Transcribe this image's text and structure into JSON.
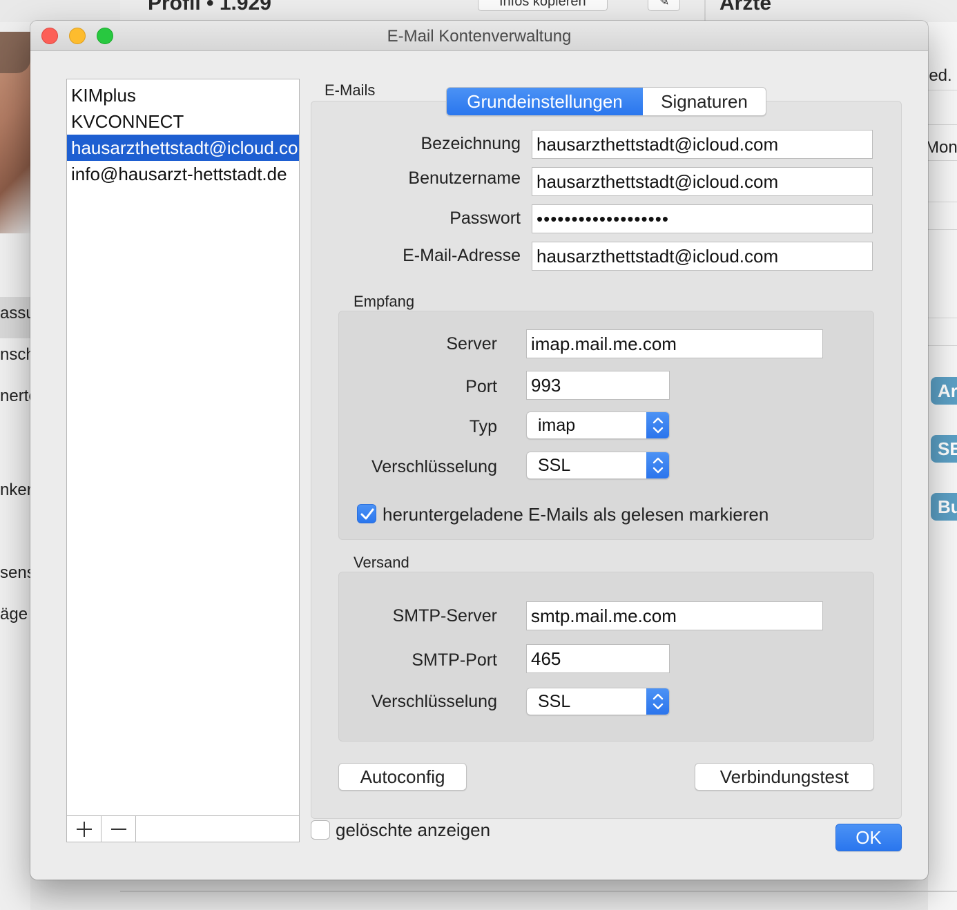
{
  "background": {
    "header_title": "Profil • 1.929",
    "header_button": "Infos kopieren",
    "header_right_title": "Ärzte",
    "left_sidebar_texts": [
      "assu",
      "nsch",
      "nerte",
      "nker",
      "sens",
      "äge"
    ],
    "right_texts": [
      "ied.",
      "Moni"
    ],
    "right_badges": [
      "Ar",
      "SE",
      "Bu"
    ]
  },
  "window": {
    "title": "E-Mail Kontenverwaltung"
  },
  "accounts": {
    "items": [
      "KIMplus",
      "KVCONNECT",
      "hausarzthettstadt@icloud.com",
      "info@hausarzt-hettstadt.de"
    ],
    "selected_index": 2,
    "add_label": "+",
    "remove_label": "—"
  },
  "emails": {
    "group_label": "E-Mails",
    "tabs": [
      {
        "label": "Grundeinstellungen",
        "active": true
      },
      {
        "label": "Signaturen",
        "active": false
      }
    ],
    "fields": {
      "bezeichnung": {
        "label": "Bezeichnung",
        "value": "hausarzthettstadt@icloud.com"
      },
      "benutzername": {
        "label": "Benutzername",
        "value": "hausarzthettstadt@icloud.com"
      },
      "passwort": {
        "label": "Passwort",
        "value": "•••••••••••••••••••"
      },
      "email_adresse": {
        "label": "E-Mail-Adresse",
        "value": "hausarzthettstadt@icloud.com"
      }
    },
    "empfang": {
      "group_label": "Empfang",
      "server": {
        "label": "Server",
        "value": "imap.mail.me.com"
      },
      "port": {
        "label": "Port",
        "value": "993"
      },
      "typ": {
        "label": "Typ",
        "value": "imap"
      },
      "verschluesselung": {
        "label": "Verschlüsselung",
        "value": "SSL"
      },
      "mark_read": {
        "label": "heruntergeladene E-Mails als gelesen markieren",
        "checked": true
      }
    },
    "versand": {
      "group_label": "Versand",
      "smtp_server": {
        "label": "SMTP-Server",
        "value": "smtp.mail.me.com"
      },
      "smtp_port": {
        "label": "SMTP-Port",
        "value": "465"
      },
      "verschluesselung": {
        "label": "Verschlüsselung",
        "value": "SSL"
      }
    },
    "autoconfig_label": "Autoconfig",
    "verbindungstest_label": "Verbindungstest"
  },
  "show_deleted": {
    "label": "gelöschte anzeigen",
    "checked": false
  },
  "ok_label": "OK",
  "colors": {
    "accent": "#2a76ee",
    "selection": "#1e5fd1",
    "close": "#fc5f57",
    "minimize": "#fdbc2e",
    "maximize": "#28c840"
  }
}
